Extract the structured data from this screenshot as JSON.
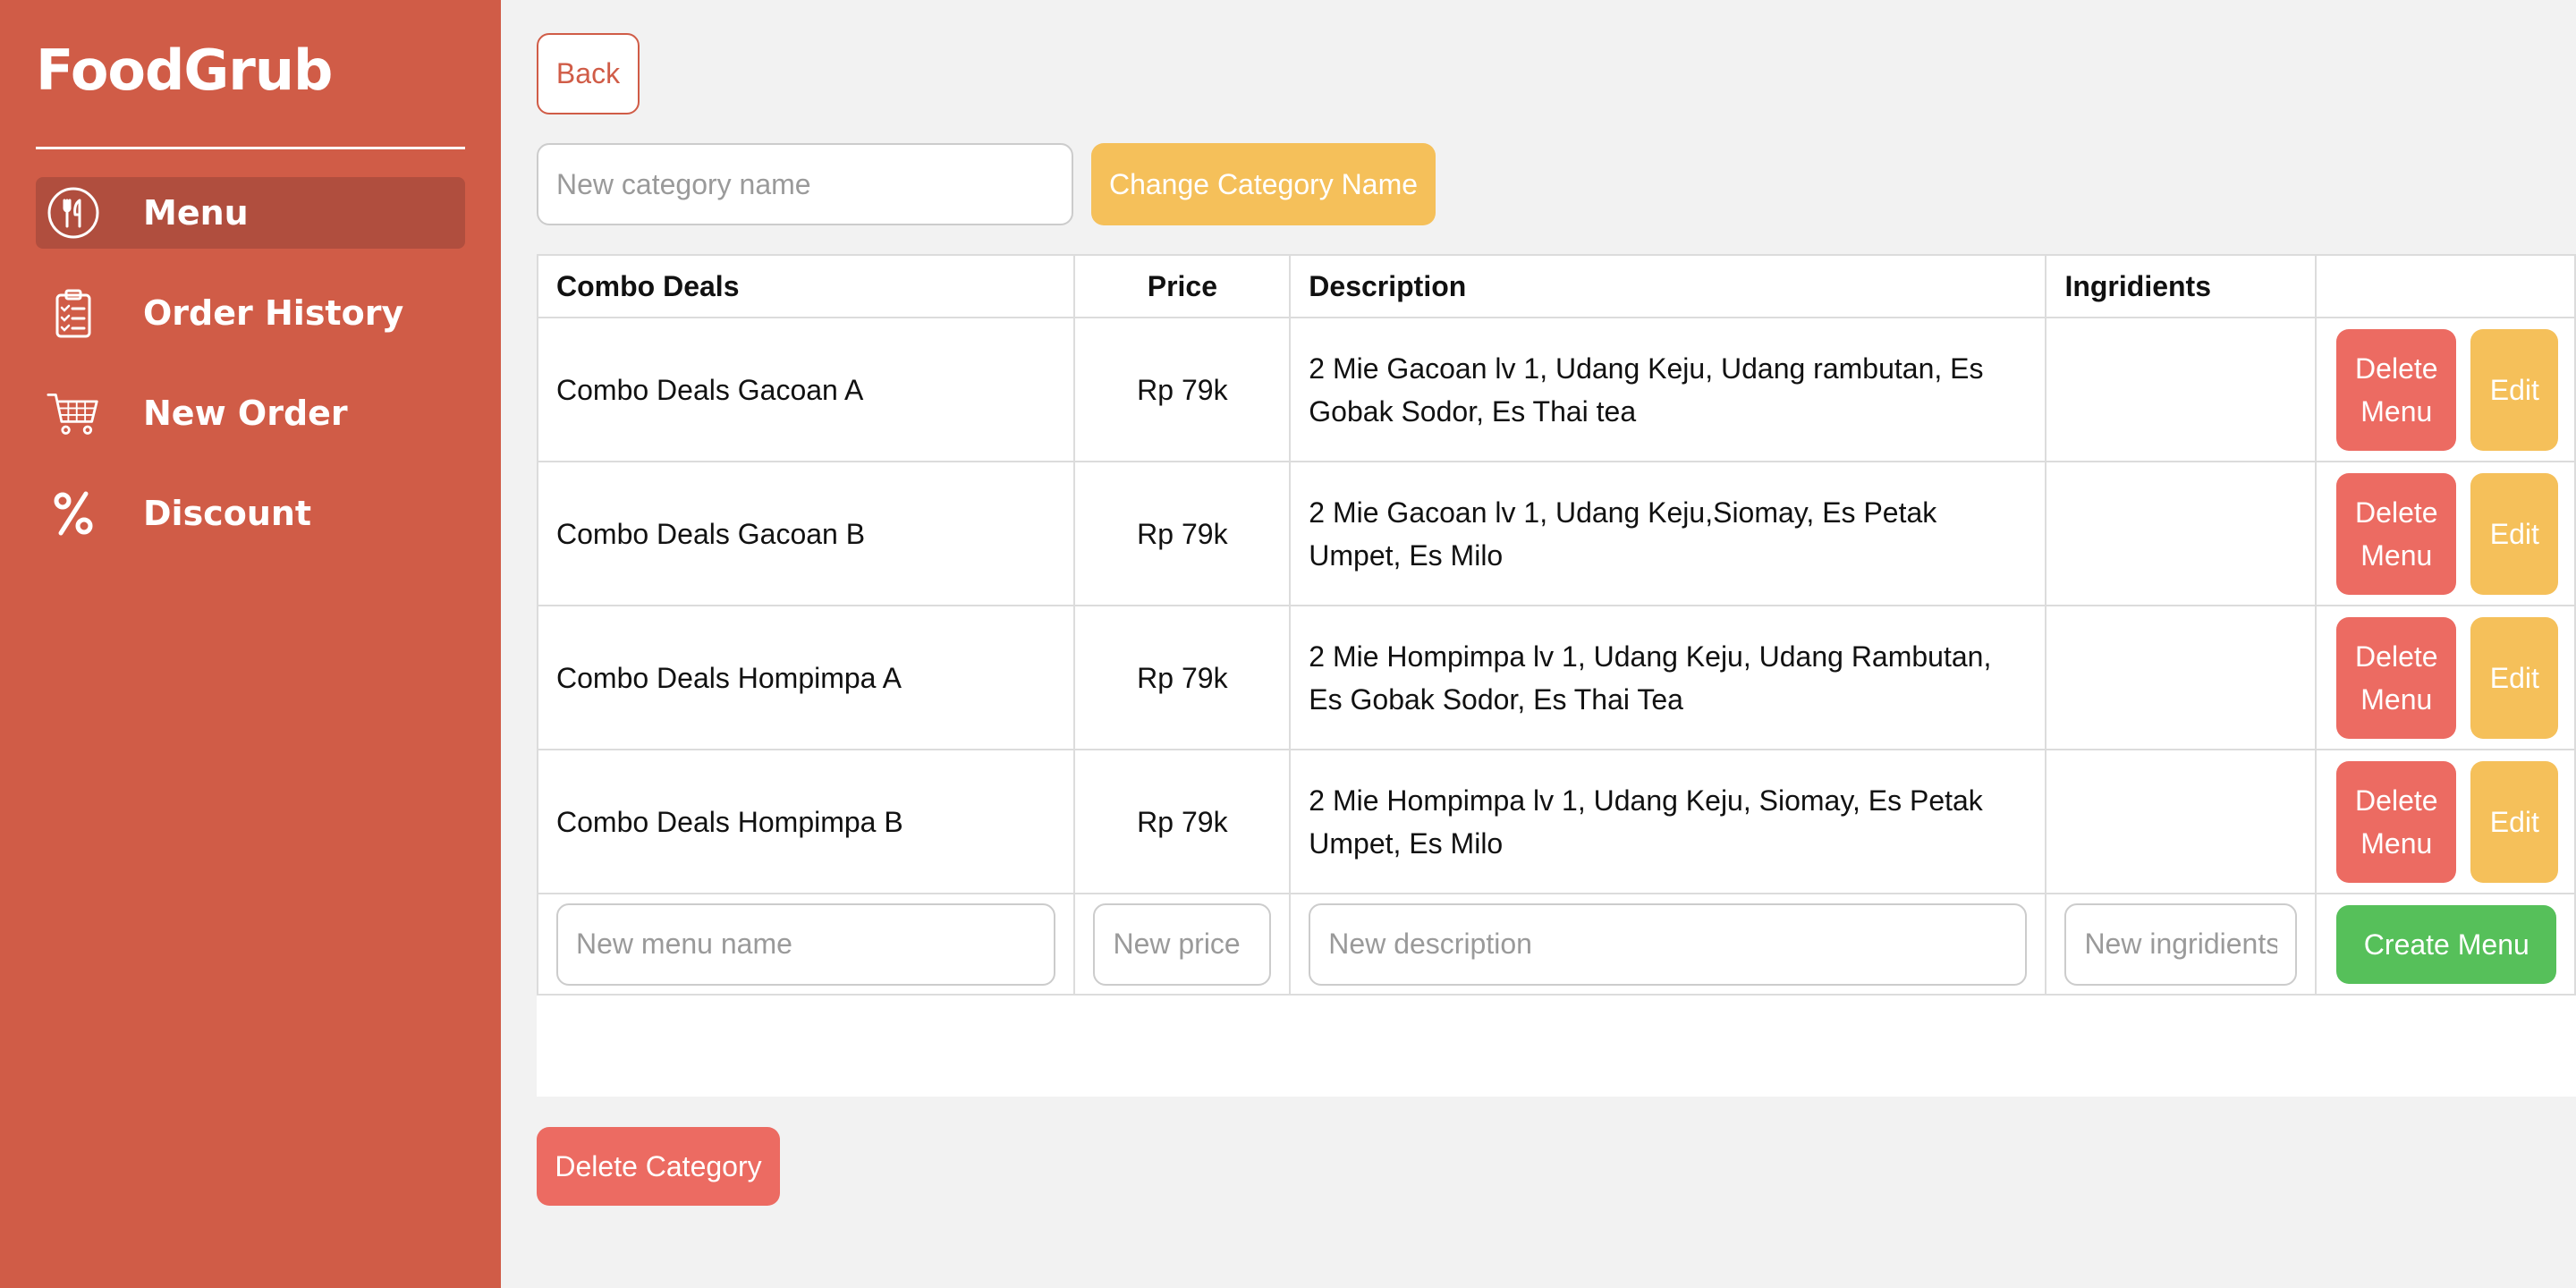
{
  "app": {
    "brand": "FoodGrub"
  },
  "sidebar": {
    "items": [
      {
        "label": "Menu",
        "icon": "utensils-icon",
        "active": true
      },
      {
        "label": "Order History",
        "icon": "clipboard-list-icon",
        "active": false
      },
      {
        "label": "New Order",
        "icon": "cart-icon",
        "active": false
      },
      {
        "label": "Discount",
        "icon": "percent-icon",
        "active": false
      }
    ]
  },
  "toolbar": {
    "back_label": "Back",
    "category_placeholder": "New category name",
    "change_category_label": "Change Category Name"
  },
  "table": {
    "headers": [
      "Combo Deals",
      "Price",
      "Description",
      "Ingridients",
      ""
    ],
    "rows": [
      {
        "name": "Combo Deals Gacoan A",
        "price": "Rp 79k",
        "description": "2 Mie Gacoan lv 1, Udang Keju, Udang rambutan, Es Gobak Sodor, Es Thai tea",
        "ingredients": "",
        "delete_label": "Delete Menu",
        "edit_label": "Edit"
      },
      {
        "name": "Combo Deals Gacoan B",
        "price": "Rp 79k",
        "description": "2 Mie Gacoan lv 1, Udang Keju,Siomay, Es Petak Umpet, Es Milo",
        "ingredients": "",
        "delete_label": "Delete Menu",
        "edit_label": "Edit"
      },
      {
        "name": "Combo Deals Hompimpa A",
        "price": "Rp 79k",
        "description": "2 Mie Hompimpa lv 1, Udang Keju, Udang Rambutan, Es Gobak Sodor, Es Thai Tea",
        "ingredients": "",
        "delete_label": "Delete Menu",
        "edit_label": "Edit"
      },
      {
        "name": "Combo Deals Hompimpa B",
        "price": "Rp 79k",
        "description": "2 Mie Hompimpa lv 1, Udang Keju, Siomay, Es Petak Umpet, Es Milo",
        "ingredients": "",
        "delete_label": "Delete Menu",
        "edit_label": "Edit"
      }
    ],
    "new_row": {
      "name_placeholder": "New menu name",
      "price_placeholder": "New price",
      "description_placeholder": "New description",
      "ingredients_placeholder": "New ingridients",
      "create_label": "Create Menu"
    }
  },
  "footer": {
    "delete_category_label": "Delete Category"
  },
  "colors": {
    "sidebar": "#d05c47",
    "active_nav": "#b04e3e",
    "delete": "#ec6b62",
    "edit": "#f5c05a",
    "create": "#56c05a"
  }
}
